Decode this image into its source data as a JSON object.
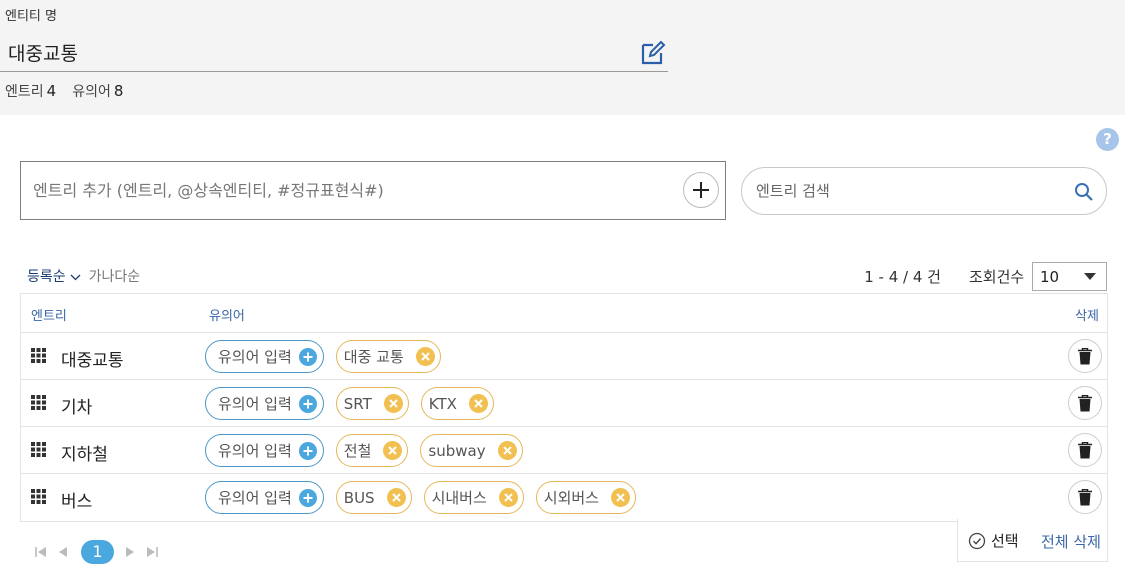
{
  "header": {
    "entity_name_label": "엔티티 명",
    "entity_name": "대중교통",
    "edit_icon": "edit-icon",
    "entries_label": "엔트리",
    "entries_count": "4",
    "synonyms_label": "유의어",
    "synonyms_count": "8"
  },
  "add_entry": {
    "placeholder": "엔트리 추가 (엔트리, @상속엔티티, #정규표현식#)"
  },
  "search": {
    "placeholder": "엔트리 검색"
  },
  "sort": {
    "active": "등록순",
    "other": "가나다순"
  },
  "paging": {
    "range": "1 - 4 / 4 건",
    "page_size_label": "조회건수",
    "page_size": "10",
    "current_page": "1"
  },
  "table": {
    "col_entry": "엔트리",
    "col_synonym": "유의어",
    "col_delete": "삭제",
    "add_synonym_label": "유의어 입력",
    "rows": [
      {
        "entry": "대중교통",
        "synonyms": [
          "대중 교통"
        ]
      },
      {
        "entry": "기차",
        "synonyms": [
          "SRT",
          "KTX"
        ]
      },
      {
        "entry": "지하철",
        "synonyms": [
          "전철",
          "subway"
        ]
      },
      {
        "entry": "버스",
        "synonyms": [
          "BUS",
          "시내버스",
          "시외버스"
        ]
      }
    ]
  },
  "actions": {
    "select": "선택",
    "delete_all": "전체 삭제"
  },
  "colors": {
    "accent": "#4aa8df",
    "chip_border": "#e4b85a",
    "chip_x": "#f1c050",
    "header_text": "#3a67a8"
  }
}
